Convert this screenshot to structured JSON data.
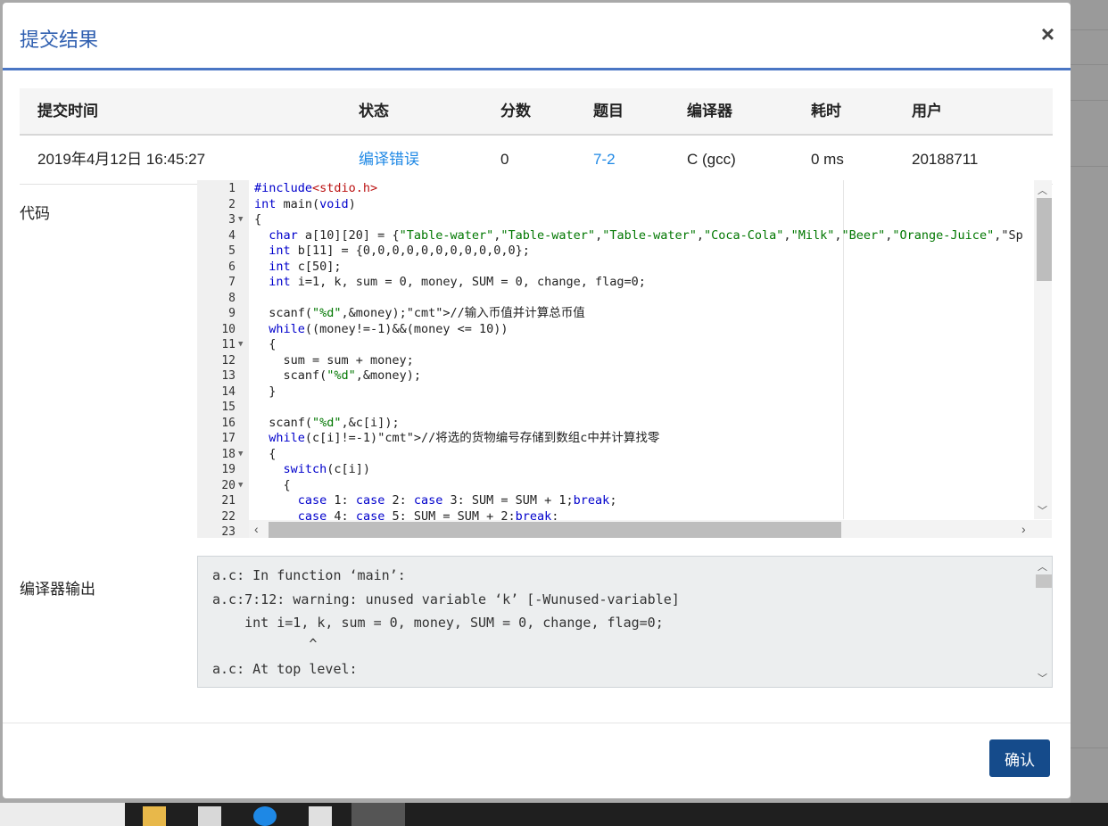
{
  "modal": {
    "title": "提交结果",
    "close_label": "×"
  },
  "table": {
    "headers": [
      "提交时间",
      "状态",
      "分数",
      "题目",
      "编译器",
      "耗时",
      "用户"
    ],
    "row": {
      "time": "2019年4月12日 16:45:27",
      "status": "编译错误",
      "score": "0",
      "problem": "7-2",
      "compiler": "C (gcc)",
      "duration": "0 ms",
      "user": "20188711"
    }
  },
  "labels": {
    "code": "代码",
    "compiler_output": "编译器输出"
  },
  "code_lines": [
    "#include<stdio.h>",
    "int main(void)",
    "{",
    "  char a[10][20] = {\"Table-water\",\"Table-water\",\"Table-water\",\"Coca-Cola\",\"Milk\",\"Beer\",\"Orange-Juice\",\"Sp",
    "  int b[11] = {0,0,0,0,0,0,0,0,0,0,0};",
    "  int c[50];",
    "  int i=1, k, sum = 0, money, SUM = 0, change, flag=0;",
    "",
    "  scanf(\"%d\",&money);//输入币值并计算总币值",
    "  while((money!=-1)&&(money <= 10))",
    "  {",
    "    sum = sum + money;",
    "    scanf(\"%d\",&money);",
    "  }",
    "",
    "  scanf(\"%d\",&c[i]);",
    "  while(c[i]!=-1)//将选的货物编号存储到数组c中并计算找零",
    "  {",
    "    switch(c[i])",
    "    {",
    "      case 1: case 2: case 3: SUM = SUM + 1;break;",
    "      case 4: case 5: SUM = SUM + 2;break;",
    ""
  ],
  "compiler_output_lines": [
    "a.c: In function ‘main’:",
    "a.c:7:12: warning: unused variable ‘k’ [-Wunused-variable]",
    "    int i=1, k, sum = 0, money, SUM = 0, change, flag=0;",
    "            ^",
    "a.c: At top level:"
  ],
  "footer": {
    "confirm_label": "确认"
  },
  "colors": {
    "accent": "#4a76c4",
    "title": "#2f5fb0",
    "link": "#1e88e5",
    "button": "#154b8b"
  }
}
